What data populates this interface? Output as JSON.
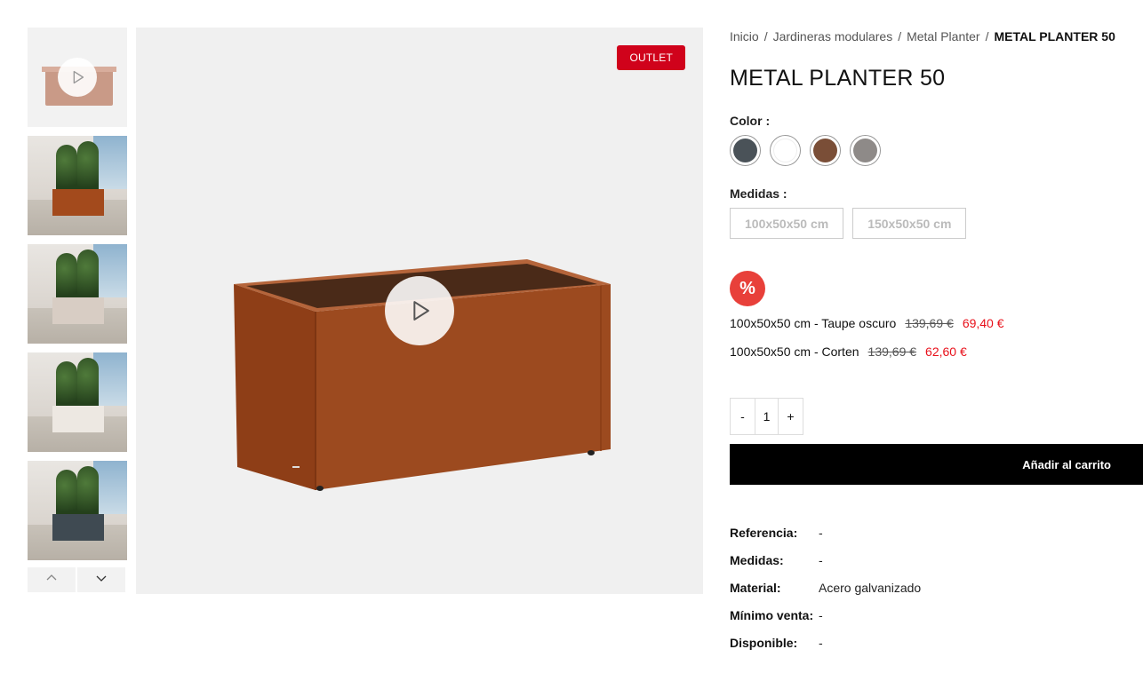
{
  "gallery": {
    "thumbnails": [
      {
        "type": "video",
        "icon": "play-icon"
      },
      {
        "type": "image",
        "planter_color": "#a34a1c"
      },
      {
        "type": "image",
        "planter_color": "#d8cdc4"
      },
      {
        "type": "image",
        "planter_color": "#ede8e2"
      },
      {
        "type": "image",
        "planter_color": "#3f4a52"
      }
    ],
    "nav_up_icon": "chevron-up-icon",
    "nav_down_icon": "chevron-down-icon"
  },
  "main_image": {
    "badge": "OUTLET",
    "badge_color": "#d0021b",
    "planter_color": "#9c4a1f",
    "play_icon": "play-icon"
  },
  "breadcrumb": {
    "items": [
      "Inicio",
      "Jardineras modulares",
      "Metal Planter"
    ],
    "separator": "/",
    "current": "METAL PLANTER 50"
  },
  "product": {
    "title": "METAL PLANTER 50",
    "color_label": "Color",
    "colors": [
      "#4a5258",
      "#ffffff",
      "#7a4e37",
      "#8e8a88"
    ],
    "size_label": "Medidas",
    "sizes": [
      "100x50x50 cm",
      "150x50x50 cm"
    ],
    "discount_symbol": "%",
    "offers": [
      {
        "name": "100x50x50 cm - Taupe oscuro",
        "old_price": "139,69 €",
        "new_price": "69,40 €"
      },
      {
        "name": "100x50x50 cm - Corten",
        "old_price": "139,69 €",
        "new_price": "62,60 €"
      }
    ],
    "quantity": {
      "minus": "-",
      "value": "1",
      "plus": "+"
    },
    "add_to_cart": "Añadir al carrito",
    "specs": [
      {
        "key": "Referencia:",
        "value": "-"
      },
      {
        "key": "Medidas:",
        "value": "-"
      },
      {
        "key": "Material:",
        "value": "Acero galvanizado"
      },
      {
        "key": "Mínimo venta:",
        "value": "-"
      },
      {
        "key": "Disponible:",
        "value": "-"
      }
    ]
  }
}
